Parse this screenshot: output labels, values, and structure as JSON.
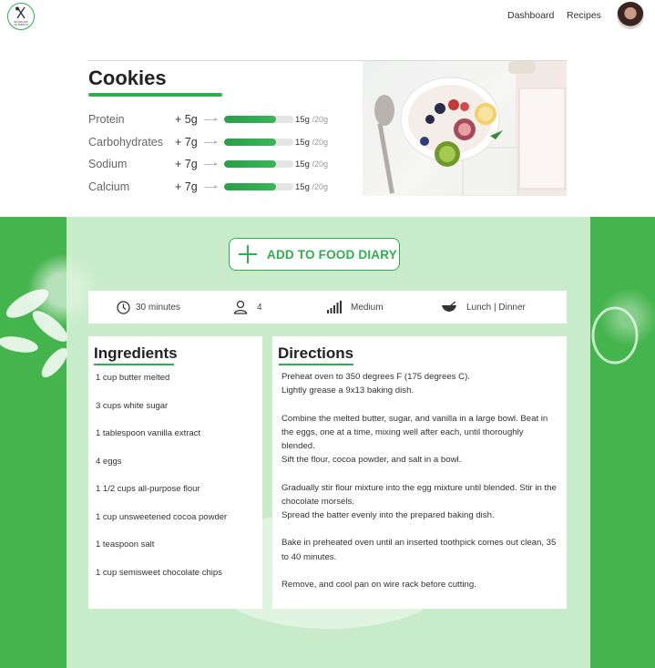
{
  "header": {
    "logo_text": "RECIPE APP NUTRIENTS",
    "nav": {
      "dashboard": "Dashboard",
      "recipes": "Recipes"
    }
  },
  "recipe": {
    "title": "Cookies",
    "nutrients": [
      {
        "name": "Protein",
        "add": "+ 5g",
        "value": "15g",
        "max": "/20g",
        "fill_percent": 75
      },
      {
        "name": "Carbohydrates",
        "add": "+ 7g",
        "value": "15g",
        "max": "/20g",
        "fill_percent": 75
      },
      {
        "name": "Sodium",
        "add": "+ 7g",
        "value": "15g",
        "max": "/20g",
        "fill_percent": 75
      },
      {
        "name": "Calcium",
        "add": "+ 7g",
        "value": "15g",
        "max": "/20g",
        "fill_percent": 75
      }
    ]
  },
  "actions": {
    "add_to_diary": "ADD TO FOOD DIARY"
  },
  "info": {
    "time": "30 minutes",
    "servings": "4",
    "difficulty": "Medium",
    "meal": "Lunch | Dinner"
  },
  "ingredients": {
    "title": "Ingredients",
    "items": [
      "1 cup butter melted",
      "3 cups white sugar",
      "1 tablespoon vanilla extract",
      "4 eggs",
      "1 1/2 cups all-purpose flour",
      "1 cup unsweetened cocoa powder",
      "1 teaspoon salt",
      "1 cup semisweet chocolate chips"
    ]
  },
  "directions": {
    "title": "Directions",
    "lines": [
      "Preheat oven to 350 degrees F (175 degrees C).",
      "Lightly grease a 9x13 baking dish.",
      "",
      "Combine the melted butter, sugar, and vanilla in a large bowl. Beat in the eggs, one at a time, mixing well after each, until thoroughly blended.",
      "Sift the flour, cocoa powder, and salt in a bowl.",
      "",
      "Gradually stir flour mixture into the egg mixture until blended. Stir in the chocolate morsels.",
      "Spread the batter evenly into the prepared baking dish.",
      "",
      "Bake in preheated oven until an inserted toothpick comes out clean, 35 to 40 minutes.",
      "",
      "Remove, and cool pan on wire rack before cutting."
    ]
  },
  "colors": {
    "accent": "#2fae4e",
    "background_green": "#44b44c",
    "overlay": "#def5de"
  }
}
